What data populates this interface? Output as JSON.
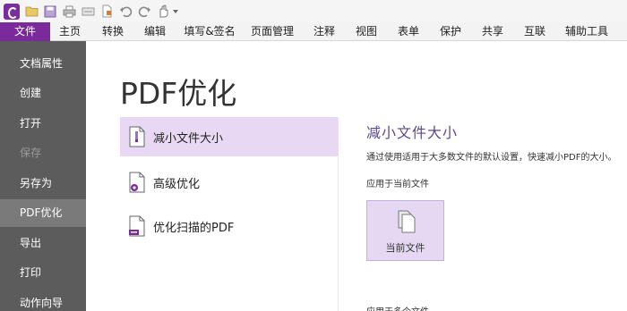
{
  "ribbon": {
    "tabs": [
      "文件",
      "主页",
      "转换",
      "编辑",
      "填写&签名",
      "页面管理",
      "注释",
      "视图",
      "表单",
      "保护",
      "共享",
      "互联",
      "辅助工具"
    ]
  },
  "nav": {
    "items": [
      {
        "label": "文档属性",
        "state": "normal"
      },
      {
        "label": "创建",
        "state": "normal"
      },
      {
        "label": "打开",
        "state": "normal"
      },
      {
        "label": "保存",
        "state": "disabled"
      },
      {
        "label": "另存为",
        "state": "normal"
      },
      {
        "label": "PDF优化",
        "state": "active"
      },
      {
        "label": "导出",
        "state": "normal"
      },
      {
        "label": "打印",
        "state": "normal"
      },
      {
        "label": "动作向导",
        "state": "normal"
      }
    ]
  },
  "page": {
    "title": "PDF优化"
  },
  "options": [
    {
      "label": "减小文件大小",
      "icon": "zip-document-icon",
      "selected": true
    },
    {
      "label": "高级优化",
      "icon": "gear-document-icon",
      "selected": false
    },
    {
      "label": "优化扫描的PDF",
      "icon": "scanner-document-icon",
      "selected": false
    }
  ],
  "detail": {
    "title": "减小文件大小",
    "description": "通过使用适用于大多数文件的默认设置，快速减小PDF的大小。",
    "apply_current_label": "应用于当前文件",
    "current_file_button": "当前文件",
    "apply_multiple_label": "应用于多个文件"
  },
  "colors": {
    "accent": "#7b2a9c",
    "nav_bg": "#5c5c5c",
    "selected_bg": "#e9d8f3"
  }
}
